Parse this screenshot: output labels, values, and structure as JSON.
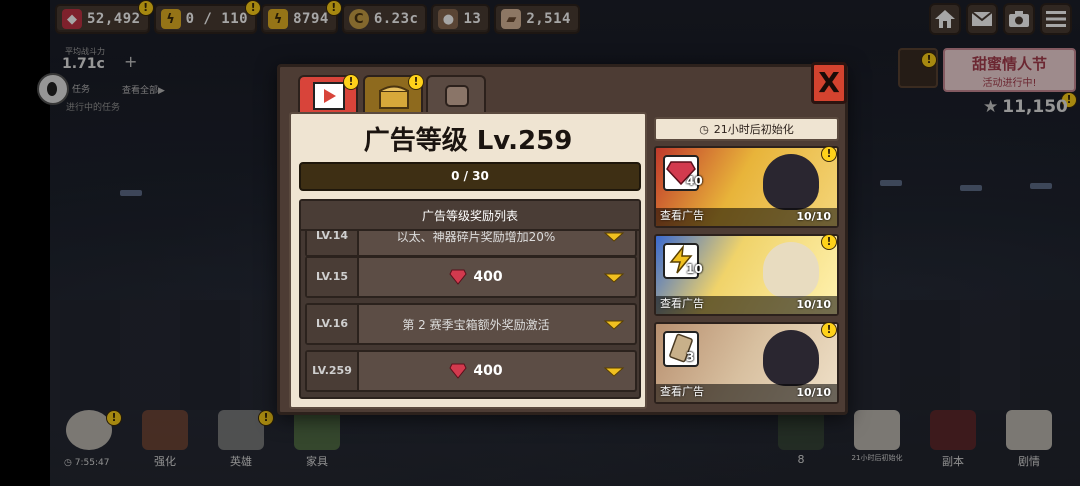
{
  "resources": [
    {
      "icon": "gem-icon",
      "value": "52,492",
      "alert": "!"
    },
    {
      "icon": "energy-icon",
      "value": "0 / 110",
      "alert": "!"
    },
    {
      "icon": "power-icon",
      "value": "8794",
      "alert": "!"
    },
    {
      "icon": "coin-icon",
      "value": "6.23c"
    },
    {
      "icon": "ore-icon",
      "value": "13"
    },
    {
      "icon": "stone-icon",
      "value": "2,514"
    }
  ],
  "hud": {
    "power_label": "平均战斗力",
    "power_value": "1.71c",
    "plus": "+",
    "quest_text": "任务",
    "quest_all": "查看全部▶",
    "quest_sub": "进行中的任务",
    "event_title": "甜蜜情人节",
    "event_sub": "活动进行中!",
    "stars": "11,150",
    "timer": "7:55:47",
    "bottom_left": [
      "强化",
      "英雄",
      "家具"
    ],
    "bottom_right_count": "8",
    "bottom_right": [
      "21小时后初始化",
      "副本",
      "剧情"
    ]
  },
  "modal": {
    "title": "广告等级 Lv.259",
    "progress": "0 / 30",
    "list_header": "广告等级奖励列表",
    "rows": [
      {
        "level": "LV.14",
        "text": "以太、神器碎片奖励增加20%",
        "gems": ""
      },
      {
        "level": "LV.15",
        "text": "",
        "gems": "400"
      },
      {
        "level": "LV.16",
        "text": "第 2 赛季宝箱额外奖励激活",
        "gems": ""
      },
      {
        "level": "LV.259",
        "text": "",
        "gems": "400"
      }
    ],
    "reset_text": "21小时后初始化",
    "cards": [
      {
        "count": "40",
        "watch": "查看广告",
        "cap": "10/10",
        "theme": "#e8b43a"
      },
      {
        "count": "10",
        "watch": "查看广告",
        "cap": "10/10",
        "theme": "#f0d36a"
      },
      {
        "count": "3",
        "watch": "查看广告",
        "cap": "10/10",
        "theme": "#c8a070"
      }
    ],
    "close": "X"
  },
  "colors": {
    "accent_red": "#d4432f",
    "alert_yellow": "#ffd21a",
    "panel_bg": "#efe4d2",
    "frame_brown": "#4d3c34"
  }
}
